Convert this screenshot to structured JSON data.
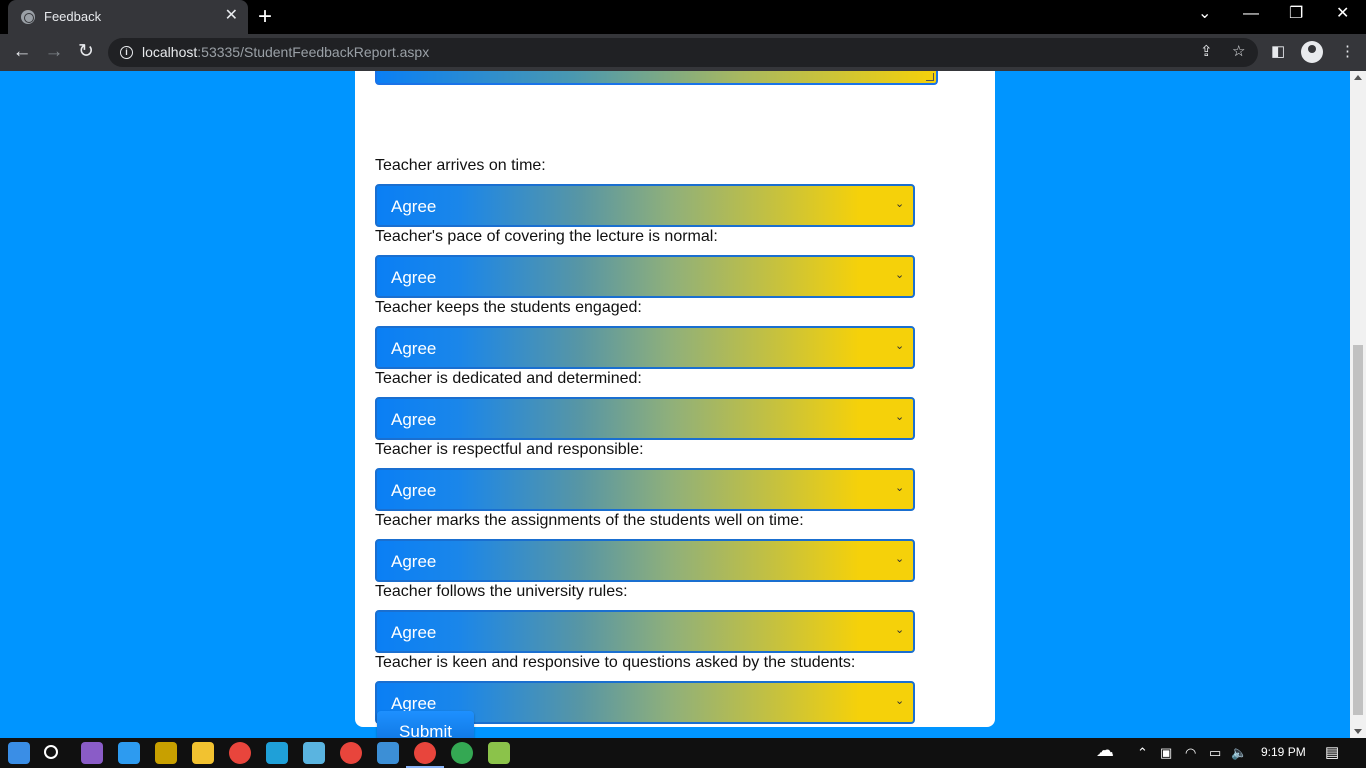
{
  "browser": {
    "tab_title": "Feedback",
    "tab_close_glyph": "✕",
    "new_tab_glyph": "+",
    "url_host": "localhost",
    "url_rest": ":53335/StudentFeedbackReport.aspx",
    "window_controls": {
      "dropdown": "⌄",
      "minimize": "—",
      "restore": "❐",
      "close": "✕"
    }
  },
  "form": {
    "questions": [
      {
        "label": "Teacher arrives on time:",
        "value": "Agree"
      },
      {
        "label": "Teacher's pace of covering the lecture is normal:",
        "value": "Agree"
      },
      {
        "label": "Teacher keeps the students engaged:",
        "value": "Agree"
      },
      {
        "label": "Teacher is dedicated and determined:",
        "value": "Agree"
      },
      {
        "label": "Teacher is respectful and responsible:",
        "value": "Agree"
      },
      {
        "label": "Teacher marks the assignments of the students well on time:",
        "value": "Agree"
      },
      {
        "label": "Teacher follows the university rules:",
        "value": "Agree"
      },
      {
        "label": "Teacher is keen and responsive to questions asked by the students:",
        "value": "Agree"
      }
    ],
    "submit_label": "Submit"
  },
  "taskbar": {
    "clock": "9:19 PM",
    "apps": [
      "windows-start",
      "search",
      "visual-studio",
      "vscode",
      "dosbox",
      "file-explorer",
      "chrome",
      "edge",
      "notepad",
      "chrome-2",
      "photos",
      "chrome-active",
      "chrome-3",
      "notepad-plus"
    ]
  },
  "colors": {
    "page_bg": "#0095ff",
    "gradient_start": "#0a7ff5",
    "gradient_end": "#f5d10a",
    "submit": "#0a6fd8"
  }
}
